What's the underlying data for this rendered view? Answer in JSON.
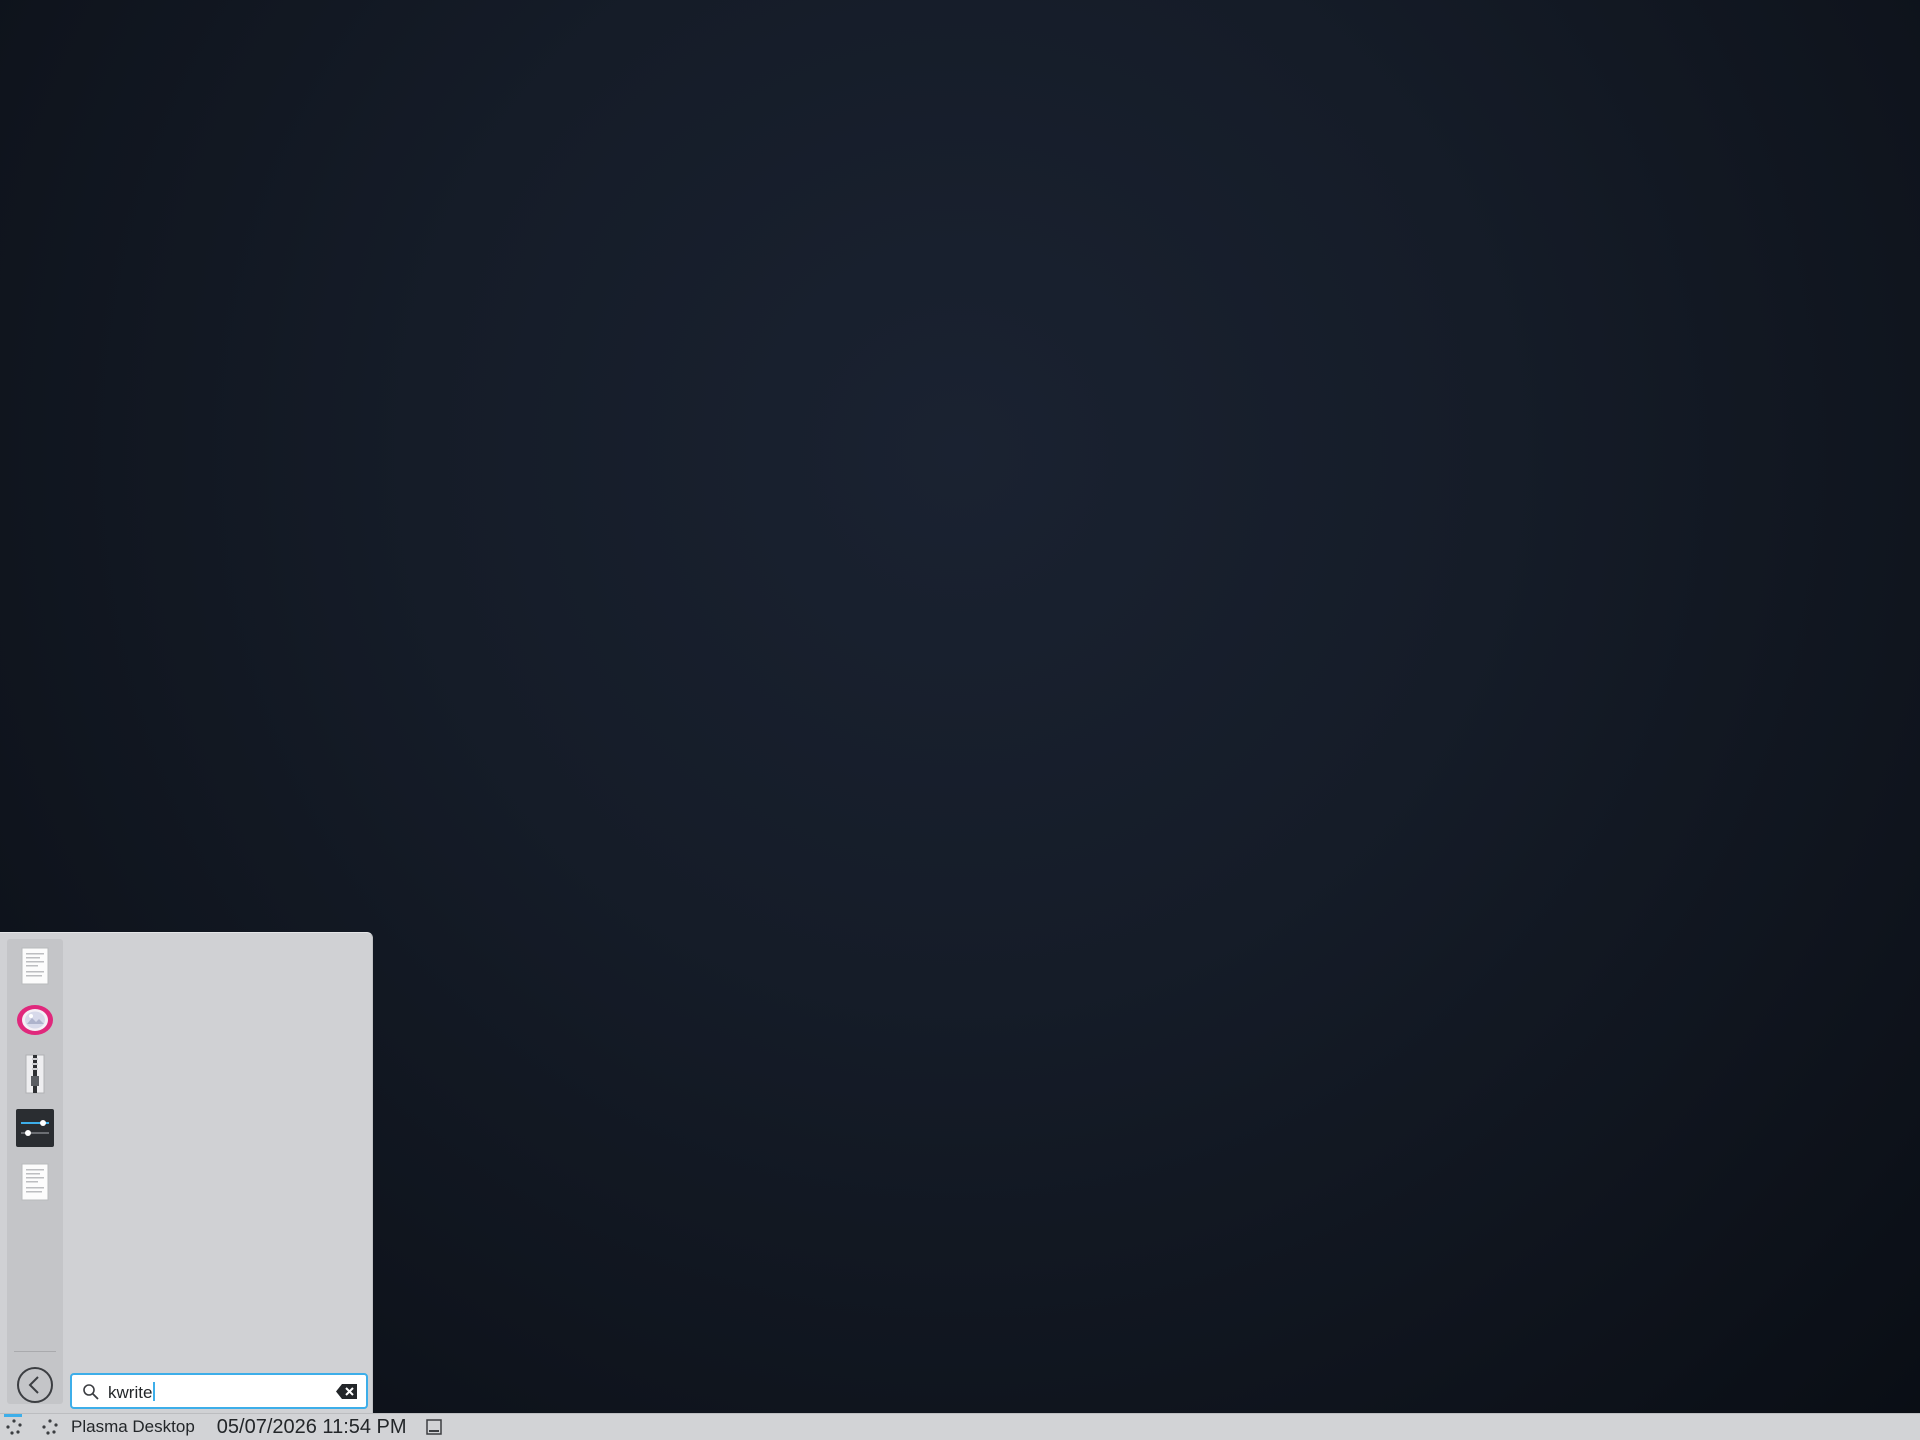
{
  "desktop": {
    "wallpaper": "dark-navy-gradient"
  },
  "launcher": {
    "favorites": [
      {
        "name": "text-document-icon"
      },
      {
        "name": "photo-viewer-icon"
      },
      {
        "name": "archive-zipper-icon"
      },
      {
        "name": "system-settings-icon"
      },
      {
        "name": "text-document-icon"
      }
    ],
    "back_icon": "chevron-left-icon",
    "search": {
      "value": "kwrite",
      "placeholder": ""
    }
  },
  "taskbar": {
    "launcher_icon": "application-launcher-icon",
    "pager_icon": "activity-pager-icon",
    "title": "Plasma Desktop",
    "clock": "05/07/2026 11:54 PM",
    "show_desktop_icon": "show-desktop-icon"
  },
  "colors": {
    "accent": "#3daee9",
    "panel": "#d2d3d6",
    "launcher_bg": "#d0d1d4"
  }
}
